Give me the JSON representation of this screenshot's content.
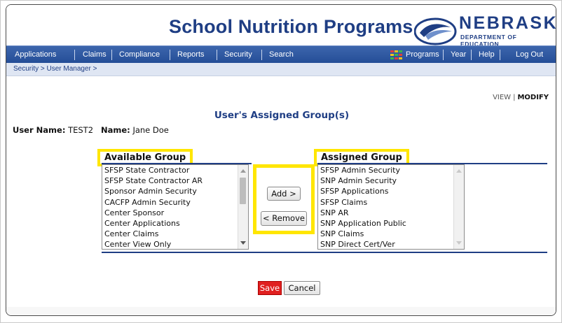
{
  "header": {
    "title": "School Nutrition Programs",
    "logo_name": "NEBRASKA",
    "logo_subtitle": "DEPARTMENT OF EDUCATION"
  },
  "nav": {
    "items": [
      "Applications",
      "Claims",
      "Compliance",
      "Reports",
      "Security",
      "Search"
    ],
    "programs": "Programs",
    "year": "Year",
    "help": "Help",
    "logout": "Log Out"
  },
  "breadcrumb": "Security > User Manager >",
  "modes": {
    "view": "VIEW",
    "separator": "|",
    "modify": "MODIFY"
  },
  "page": {
    "title": "User's Assigned Group(s)",
    "user_name_label": "User Name:",
    "user_name": "TEST2",
    "name_label": "Name:",
    "name": "Jane Doe"
  },
  "available": {
    "heading": "Available Group",
    "items": [
      "SFSP State Contractor",
      "SFSP State Contractor AR",
      "Sponsor Admin Security",
      "CACFP Admin Security",
      "Center Sponsor",
      "Center Applications",
      "Center Claims",
      "Center View Only"
    ]
  },
  "assigned": {
    "heading": "Assigned Group",
    "items": [
      "SFSP Admin Security",
      "SNP Admin Security",
      "SFSP Applications",
      "SFSP Claims",
      "SNP AR",
      "SNP Application Public",
      "SNP Claims",
      "SNP Direct Cert/Ver"
    ]
  },
  "buttons": {
    "add": "Add >",
    "remove": "< Remove",
    "save": "Save",
    "cancel": "Cancel"
  },
  "colors": {
    "brand_blue": "#1f3e84",
    "highlight_yellow": "#ffe600",
    "save_red": "#e02020"
  }
}
